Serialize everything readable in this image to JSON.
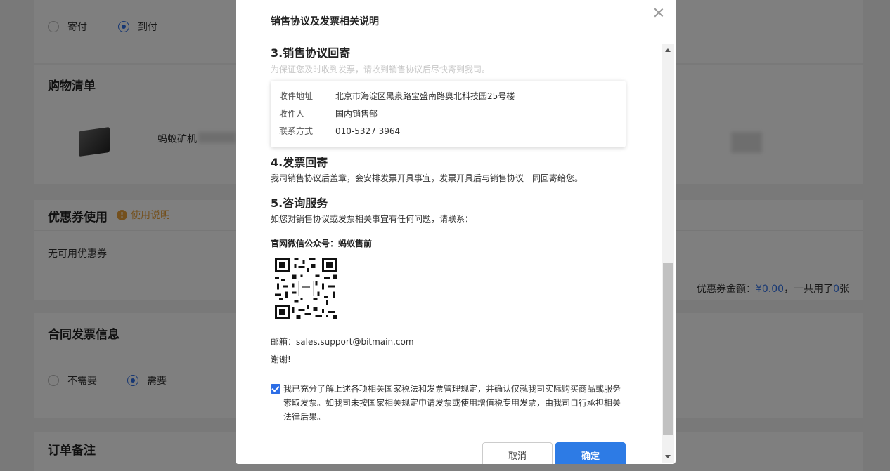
{
  "background": {
    "payment": {
      "option_prepaid": "寄付",
      "option_cod": "到付",
      "selected": "到付"
    },
    "cart": {
      "title": "购物清单",
      "product_name": "蚂蚁矿机"
    },
    "coupon": {
      "title": "优惠券使用",
      "usage_link": "使用说明",
      "none_text": "无可用优惠券",
      "sum_label": "优惠券金额：",
      "sum_amount": "¥0.00",
      "used_label": "，一共用了",
      "used_count": "0",
      "used_unit": "张"
    },
    "invoice": {
      "title": "合同发票信息",
      "option_no": "不需要",
      "option_yes": "需要",
      "selected": "需要"
    },
    "remark": {
      "title": "订单备注"
    }
  },
  "modal": {
    "title": "销售协议及发票相关说明",
    "section3": {
      "heading": "3.销售协议回寄",
      "hint": "为保证您及时收到发票，请收到销售协议后尽快寄到我司。",
      "rows": [
        {
          "label": "收件地址",
          "value": "北京市海淀区黑泉路宝盛南路奥北科技园25号楼"
        },
        {
          "label": "收件人",
          "value": "国内销售部"
        },
        {
          "label": "联系方式",
          "value": "010-5327 3964"
        }
      ]
    },
    "section4": {
      "heading": "4.发票回寄",
      "text": "我司销售协议后盖章，会安排发票开具事宜，发票开具后与销售协议一同回寄给您。"
    },
    "section5": {
      "heading": "5.咨询服务",
      "text": "如您对销售协议或发票相关事宜有任何问题，请联系：",
      "wechat": "官网微信公众号：蚂蚁售前",
      "email": "邮箱：sales.support@bitmain.com",
      "thanks": "谢谢!"
    },
    "agreement": "我已充分了解上述各项相关国家税法和发票管理规定，并确认仅就我司实际购买商品或服务索取发票。如我司未按国家相关规定申请发票或使用增值税专用发票，由我司自行承担相关法律后果。",
    "agreement_checked": true,
    "cancel_label": "取消",
    "confirm_label": "确定"
  },
  "colors": {
    "accent": "#2d7be5",
    "warning": "#e8a13a",
    "overlay": "rgba(0,0,0,0.5)"
  }
}
